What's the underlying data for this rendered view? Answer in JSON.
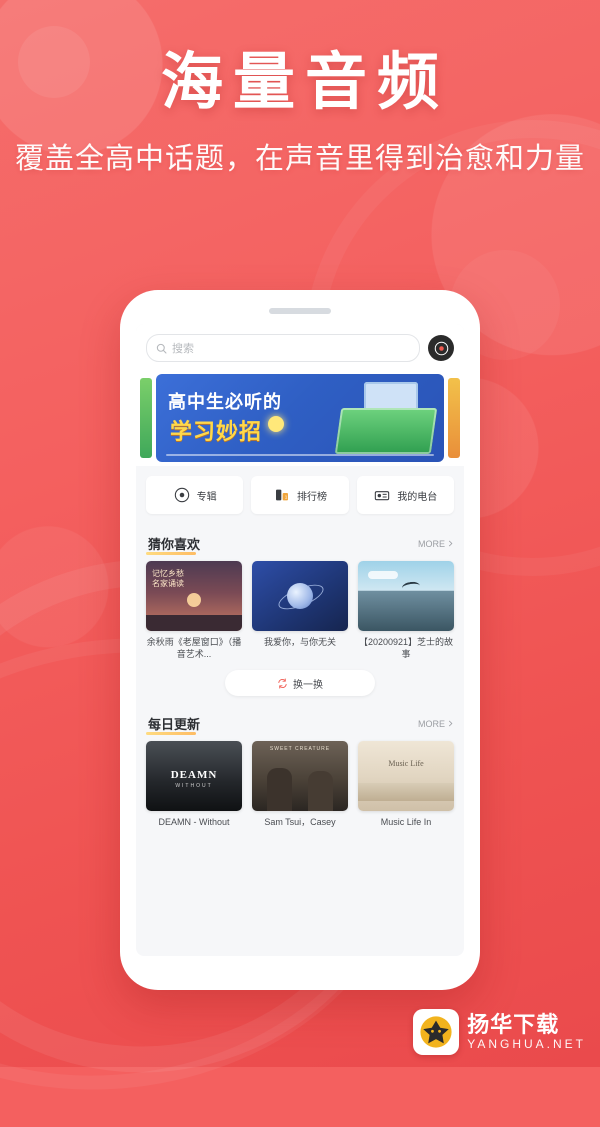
{
  "hero": {
    "title": "海量音频",
    "subtitle": "覆盖全高中话题，在声音里得到治愈和力量"
  },
  "phone": {
    "search": {
      "placeholder": "搜索",
      "icon": "search-icon",
      "mic_icon": "record-icon"
    },
    "banner": {
      "line1": "高中生必听的",
      "line2": "学习妙招"
    },
    "quick_entries": [
      {
        "label": "专辑",
        "icon": "album-icon"
      },
      {
        "label": "排行榜",
        "icon": "rank-icon"
      },
      {
        "label": "我的电台",
        "icon": "radio-icon"
      }
    ],
    "sections": [
      {
        "title": "猜你喜欢",
        "more_label": "MORE",
        "more_icon": "chevron-right-icon",
        "cards": [
          {
            "caption": "余秋雨《老屋窗口》（播音艺术...",
            "art": "t1",
            "art_text": "记忆乡愁\n名家诵读"
          },
          {
            "caption": "我爱你，与你无关",
            "art": "t2",
            "art_text": ""
          },
          {
            "caption": "【20200921】芝士的故事",
            "art": "t3",
            "art_text": ""
          }
        ],
        "refresh": {
          "label": "换一换",
          "icon": "refresh-icon"
        }
      },
      {
        "title": "每日更新",
        "more_label": "MORE",
        "more_icon": "chevron-right-icon",
        "cards": [
          {
            "caption": "DEAMN - Without",
            "art": "t4",
            "art_text": "DEAMN",
            "art_sub": "WITHOUT"
          },
          {
            "caption": "Sam Tsui，Casey",
            "art": "t5",
            "art_text": "SWEET CREATURE"
          },
          {
            "caption": "Music Life In",
            "art": "t6",
            "art_text": "Music Life"
          }
        ]
      }
    ]
  },
  "watermark": {
    "title": "扬华下载",
    "subtitle": "YANGHUA.NET",
    "badge_icon": "lion-logo-icon"
  },
  "colors": {
    "background": "#f4605f",
    "banner": "#2f5fc4",
    "accent_yellow": "#ffd84a",
    "card_bg": "#ffffff",
    "screen_bg": "#f6f7f9"
  }
}
